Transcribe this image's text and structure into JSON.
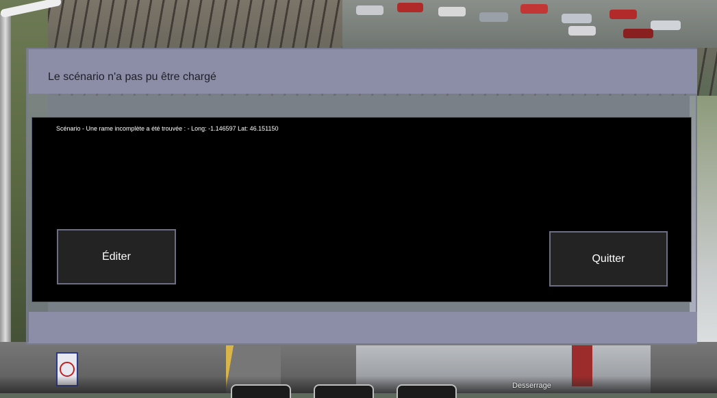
{
  "dialog": {
    "title": "Le scénario n'a pas pu être chargé",
    "message": "Scénario - Une rame incomplète a été trouvée : - Long: -1.146597 Lat: 46.151150",
    "edit_label": "Éditer",
    "quit_label": "Quitter"
  },
  "hud": {
    "brake_label": "Desserrage"
  },
  "colors": {
    "dialog_frame": "#8c8ea8",
    "dialog_body": "#000000",
    "button_bg": "#232323",
    "button_border": "#6c6e86"
  }
}
